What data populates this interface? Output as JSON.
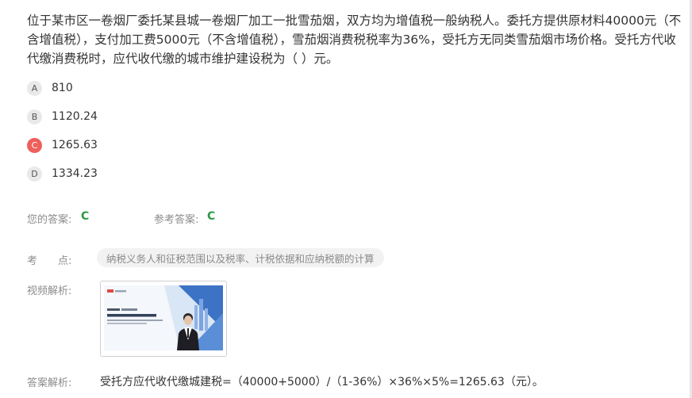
{
  "question": {
    "text": "位于某市区一卷烟厂委托某县城一卷烟厂加工一批雪茄烟，双方均为增值税一般纳税人。委托方提供原材料40000元（不含增值税），支付加工费5000元（不含增值税），雪茄烟消费税税率为36%，受托方无同类雪茄烟市场价格。受托方代收代缴消费税时，应代收代缴的城市维护建设税为（ ）元。"
  },
  "options": [
    {
      "letter": "A",
      "text": "810",
      "selected": false
    },
    {
      "letter": "B",
      "text": "1120.24",
      "selected": false
    },
    {
      "letter": "C",
      "text": "1265.63",
      "selected": true
    },
    {
      "letter": "D",
      "text": "1334.23",
      "selected": false
    }
  ],
  "answers": {
    "your_label": "您的答案:",
    "your_value": "C",
    "ref_label": "参考答案:",
    "ref_value": "C"
  },
  "knowledge": {
    "label": "考　　点:",
    "tag": "纳税义务人和征税范围以及税率、计税依据和应纳税额的计算"
  },
  "video": {
    "label": "视频解析:"
  },
  "explanation": {
    "label": "答案解析:",
    "text": "受托方应代收代缴城建税=（40000+5000）/（1-36%）×36%×5%=1265.63（元）。"
  },
  "colors": {
    "selected_option": "#ee5f5b",
    "answer_green": "#2e9a45",
    "tag_bg": "#f2f2f2"
  }
}
